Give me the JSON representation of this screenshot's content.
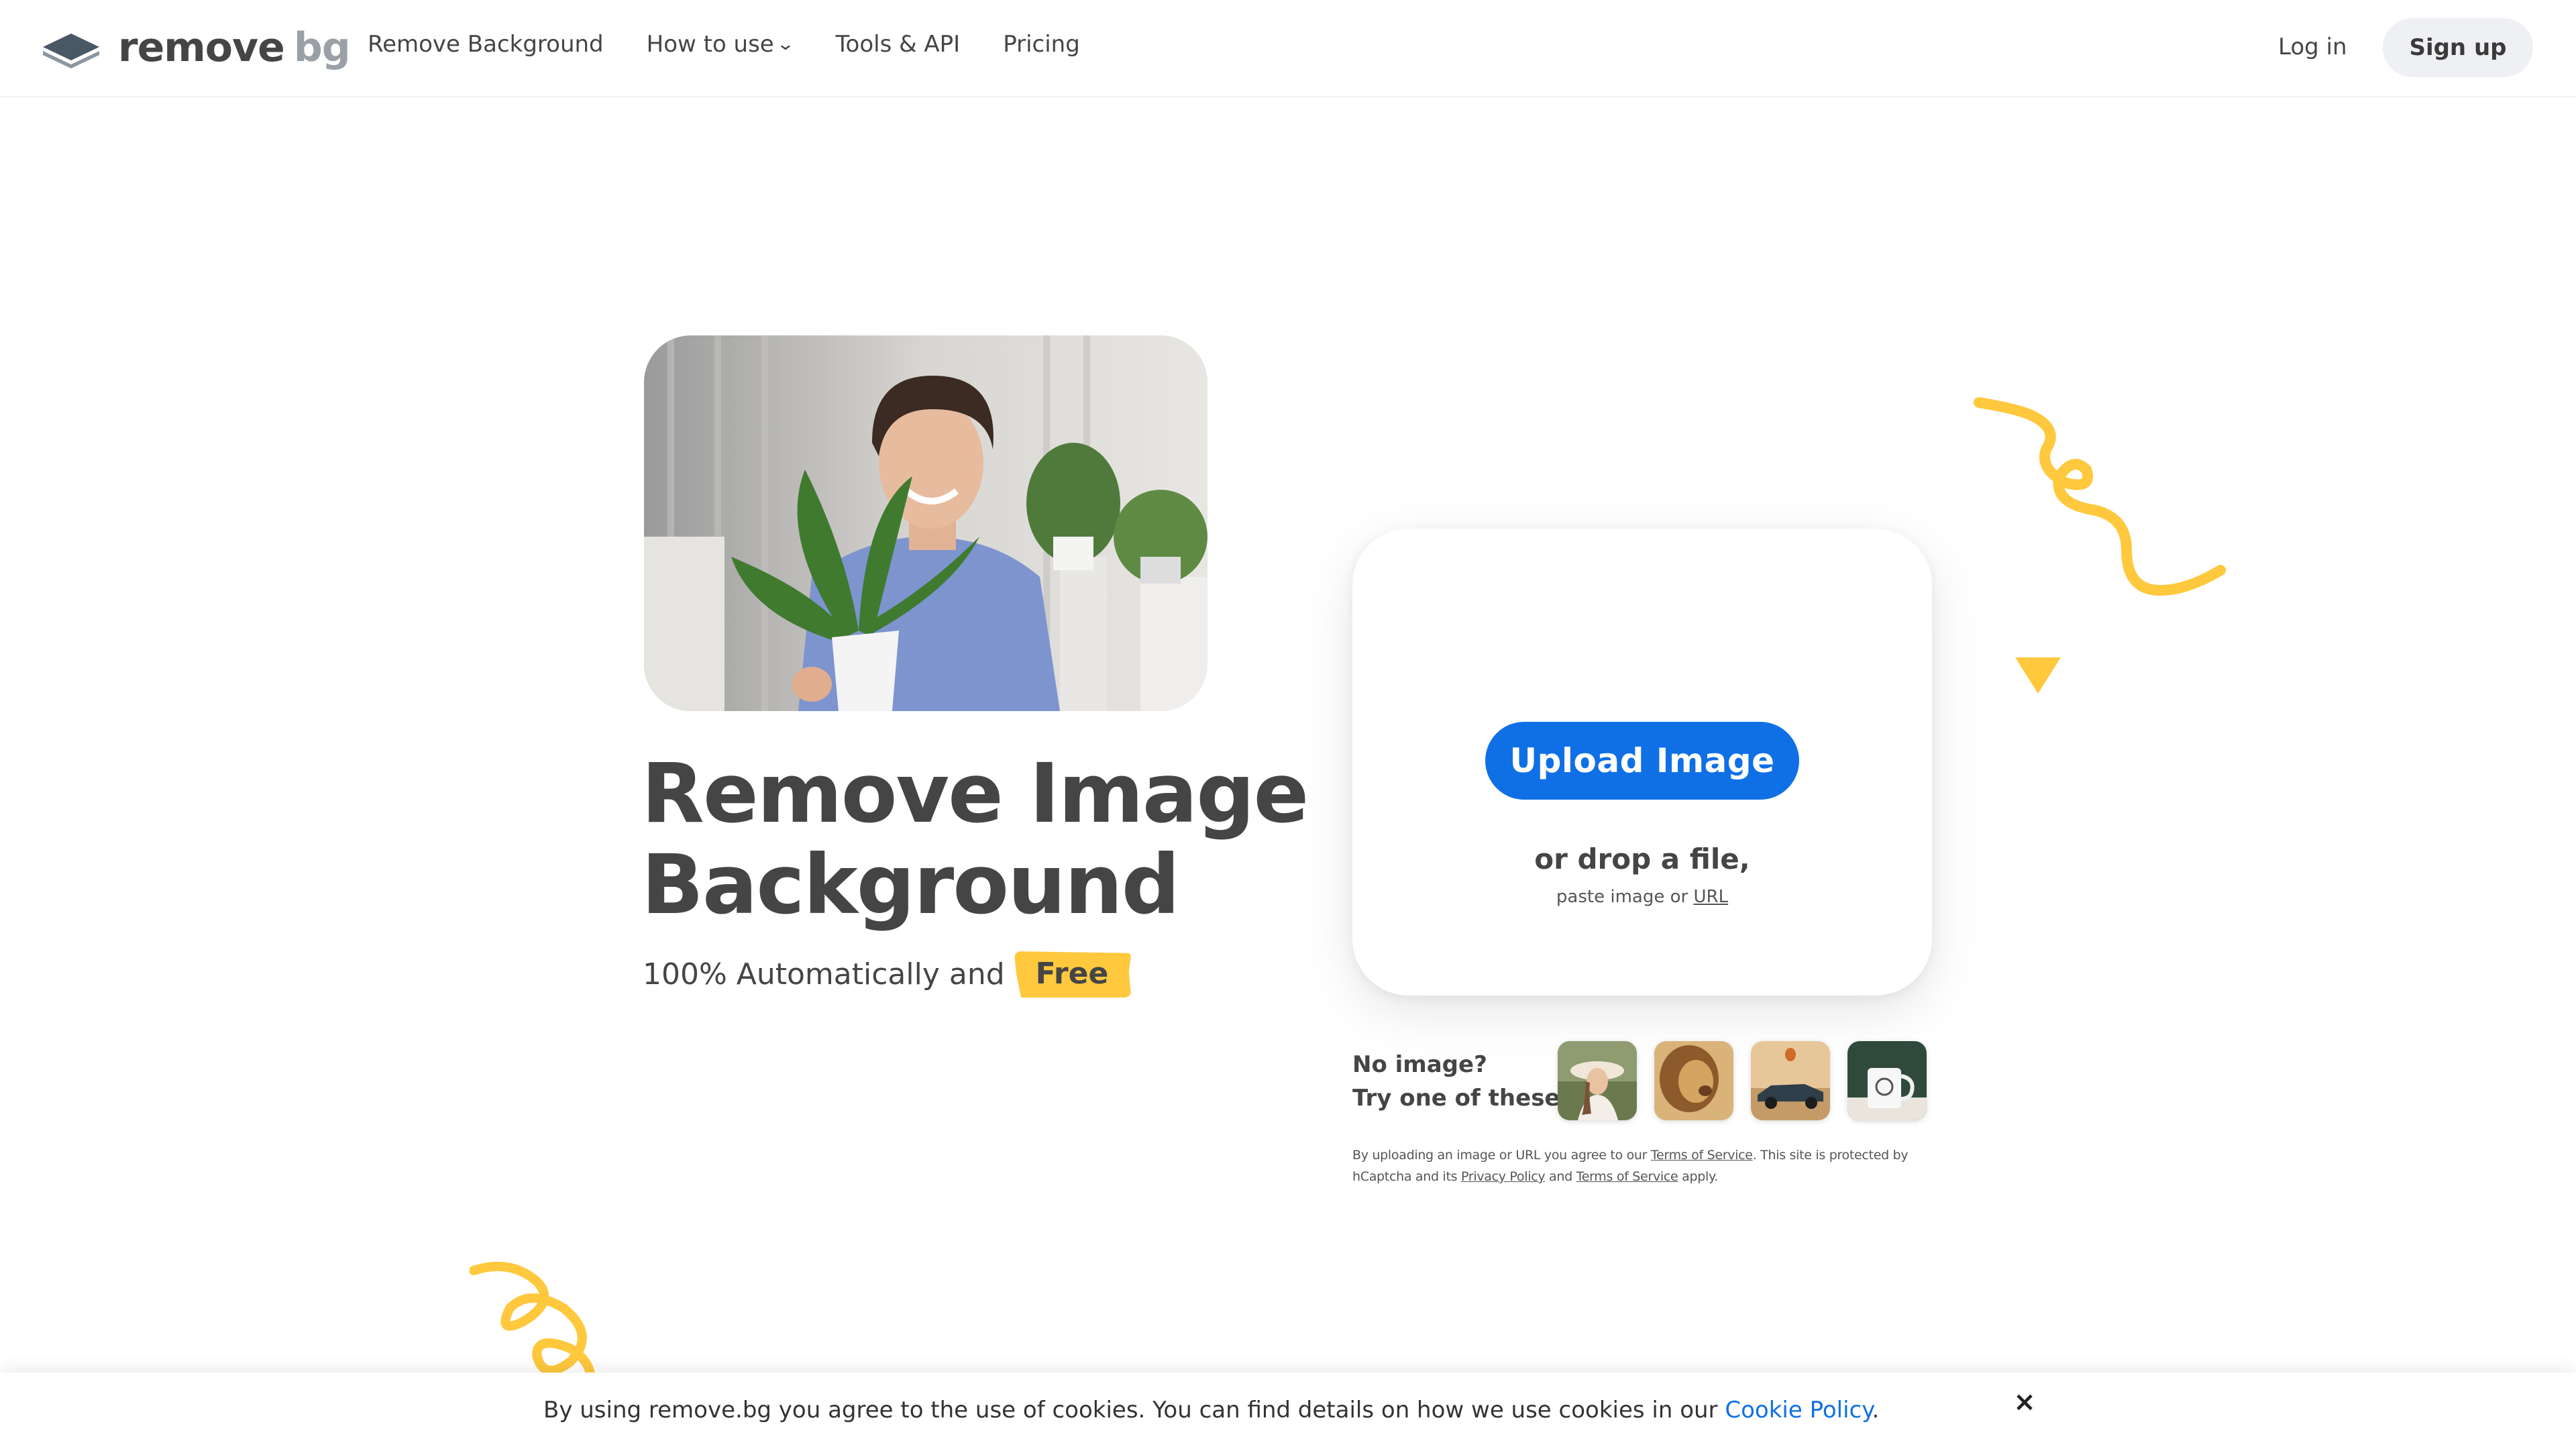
{
  "header": {
    "logo": {
      "word1": "remove",
      "word2": "bg"
    },
    "nav": {
      "remove_background": "Remove Background",
      "how_to_use": "How to use",
      "tools_api": "Tools & API",
      "pricing": "Pricing"
    },
    "login": "Log in",
    "signup": "Sign up"
  },
  "hero": {
    "headline_line1": "Remove Image",
    "headline_line2": "Background",
    "subline": "100% Automatically and",
    "free_badge": "Free"
  },
  "upload": {
    "button": "Upload Image",
    "drop_text": "or drop a file,",
    "paste_text": "paste image or",
    "url_link": "URL"
  },
  "samples": {
    "line1": "No image?",
    "line2": "Try one of these:",
    "items": [
      "woman-sample",
      "lion-sample",
      "car-sample",
      "mug-sample"
    ]
  },
  "legal": {
    "p1": "By uploading an image or URL you agree to our",
    "tos1": "Terms of Service",
    "p2": ". This site is protected by hCaptcha and its",
    "privacy": "Privacy Policy",
    "p3": "and",
    "tos2": "Terms of Service",
    "p4": "apply."
  },
  "cookie": {
    "text": "By using remove.bg you agree to the use of cookies. You can find details on how we use cookies in our",
    "link": "Cookie Policy",
    "end": ".",
    "close": "×"
  },
  "colors": {
    "accent_blue": "#0f70e6",
    "accent_yellow": "#ffc83d",
    "text": "#454545"
  }
}
